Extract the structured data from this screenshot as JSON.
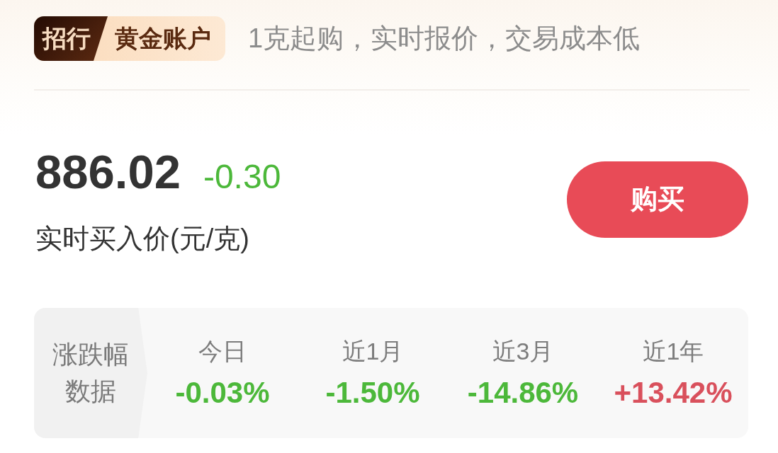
{
  "header": {
    "badge": {
      "bank": "招行",
      "product": "黄金账户"
    },
    "tagline": "1克起购，实时报价，交易成本低"
  },
  "quote": {
    "price": "886.02",
    "change": {
      "text": "-0.30",
      "color": "#4cb83a"
    },
    "caption": "实时买入价(元/克)"
  },
  "buy_button": {
    "label": "购买"
  },
  "performance": {
    "title": "涨跌幅数据",
    "periods": [
      {
        "label": "今日",
        "value": "-0.03%",
        "color": "#4cb83a"
      },
      {
        "label": "近1月",
        "value": "-1.50%",
        "color": "#4cb83a"
      },
      {
        "label": "近3月",
        "value": "-14.86%",
        "color": "#4cb83a"
      },
      {
        "label": "近1年",
        "value": "+13.42%",
        "color": "#d9505c"
      }
    ]
  }
}
